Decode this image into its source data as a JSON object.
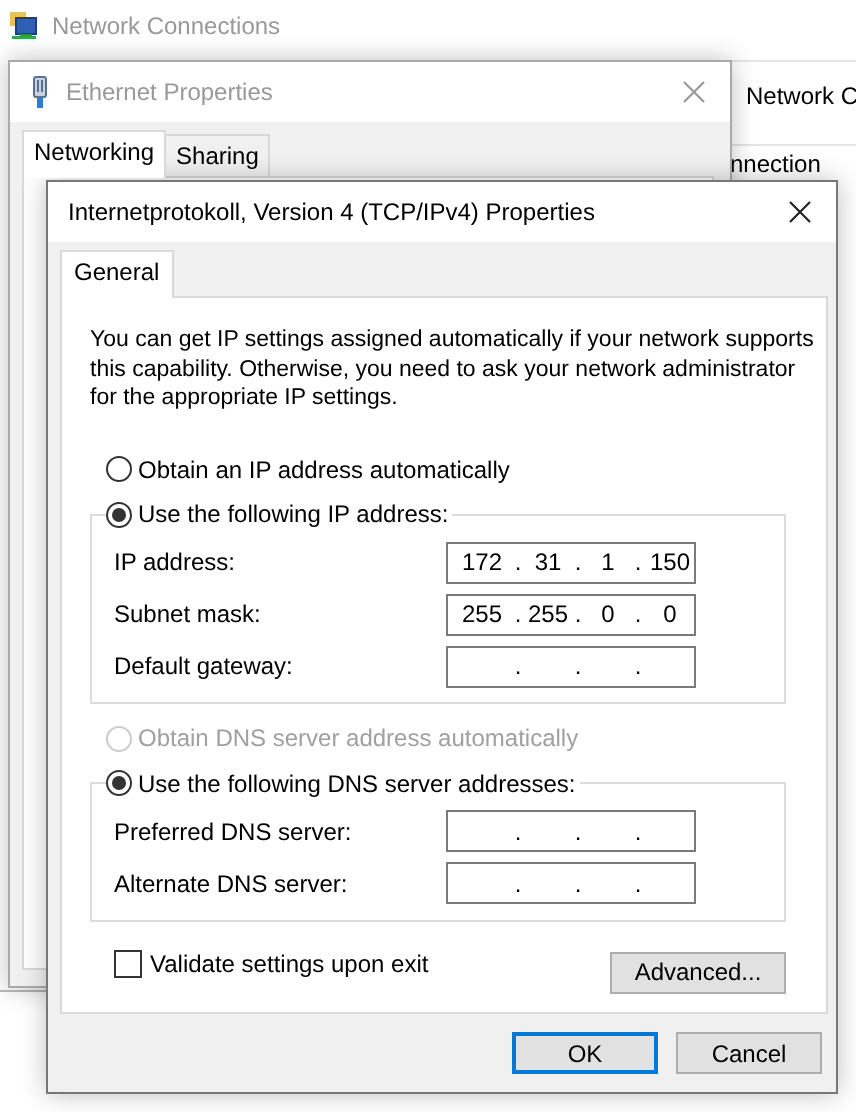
{
  "background_window": {
    "title": "Network Connections",
    "toolbar_text": "Network C",
    "list_text": "nnection"
  },
  "ethernet_window": {
    "title": "Ethernet Properties",
    "tabs": [
      {
        "label": "Networking",
        "selected": true
      },
      {
        "label": "Sharing",
        "selected": false
      }
    ]
  },
  "ipv4_dialog": {
    "title": "Internetprotokoll, Version 4 (TCP/IPv4) Properties",
    "tabs": [
      {
        "label": "General",
        "selected": true
      }
    ],
    "description": "You can get IP settings assigned automatically if your network supports this capability. Otherwise, you need to ask your network administrator for the appropriate IP settings.",
    "separator": ".",
    "ip_options": [
      {
        "label": "Obtain an IP address automatically",
        "selected": false,
        "disabled": false
      },
      {
        "label": "Use the following IP address:",
        "selected": true,
        "disabled": false
      }
    ],
    "ip_fields": [
      {
        "label": "IP address:",
        "octets": [
          "172",
          "31",
          "1",
          "150"
        ]
      },
      {
        "label": "Subnet mask:",
        "octets": [
          "255",
          "255",
          "0",
          "0"
        ]
      },
      {
        "label": "Default gateway:"
      }
    ],
    "dns_options": [
      {
        "label": "Obtain DNS server address automatically",
        "selected": false,
        "disabled": true
      },
      {
        "label": "Use the following DNS server addresses:",
        "selected": true,
        "disabled": false
      }
    ],
    "dns_fields": [
      {
        "label": "Preferred DNS server:"
      },
      {
        "label": "Alternate DNS server:"
      }
    ],
    "validate": {
      "label": "Validate settings upon exit",
      "checked": false
    },
    "advanced_button": "Advanced...",
    "buttons": [
      {
        "label": "OK",
        "default": true
      },
      {
        "label": "Cancel",
        "default": false
      }
    ]
  }
}
